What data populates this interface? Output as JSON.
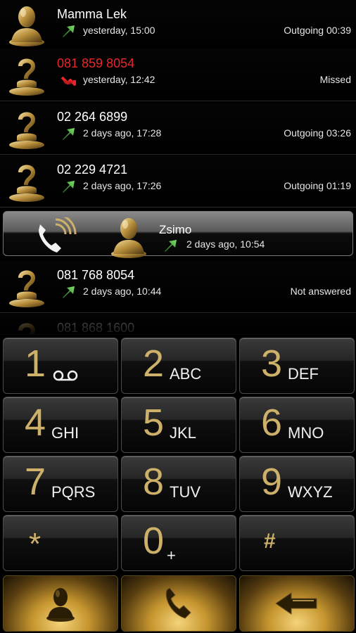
{
  "call_log": [
    {
      "name": "Mamma Lek",
      "direction": "outgoing",
      "time": "yesterday, 15:00",
      "status": "Outgoing 00:39"
    },
    {
      "name": "081 859 8054",
      "direction": "missed",
      "time": "yesterday, 12:42",
      "status": "Missed"
    },
    {
      "name": "02 264 6899",
      "direction": "outgoing",
      "time": "2 days ago, 17:28",
      "status": "Outgoing 03:26"
    },
    {
      "name": "02 229 4721",
      "direction": "outgoing",
      "time": "2 days ago, 17:26",
      "status": "Outgoing 01:19"
    },
    {
      "name": "Zsimo",
      "direction": "outgoing",
      "time": "2 days ago, 10:54",
      "status": ""
    },
    {
      "name": "081 768 8054",
      "direction": "outgoing",
      "time": "2 days ago, 10:44",
      "status": "Not answered"
    },
    {
      "name": "081 868 1600",
      "direction": "outgoing",
      "time": "",
      "status": ""
    }
  ],
  "keypad": [
    {
      "digit": "1",
      "letters": "",
      "icon": "voicemail-icon"
    },
    {
      "digit": "2",
      "letters": "ABC"
    },
    {
      "digit": "3",
      "letters": "DEF"
    },
    {
      "digit": "4",
      "letters": "GHI"
    },
    {
      "digit": "5",
      "letters": "JKL"
    },
    {
      "digit": "6",
      "letters": "MNO"
    },
    {
      "digit": "7",
      "letters": "PQRS"
    },
    {
      "digit": "8",
      "letters": "TUV"
    },
    {
      "digit": "9",
      "letters": "WXYZ"
    },
    {
      "digit": "*",
      "letters": ""
    },
    {
      "digit": "0",
      "letters": "+"
    },
    {
      "digit": "#",
      "letters": ""
    }
  ],
  "actions": [
    {
      "name": "contacts-button",
      "icon": "contact-silhouette-icon"
    },
    {
      "name": "call-button",
      "icon": "phone-handset-icon"
    },
    {
      "name": "backspace-button",
      "icon": "backspace-arrow-icon"
    }
  ],
  "colors": {
    "accent_gold": "#cdb16a",
    "missed_red": "#e8262a",
    "outgoing_green": "#3fae3a",
    "background": "#000000"
  }
}
